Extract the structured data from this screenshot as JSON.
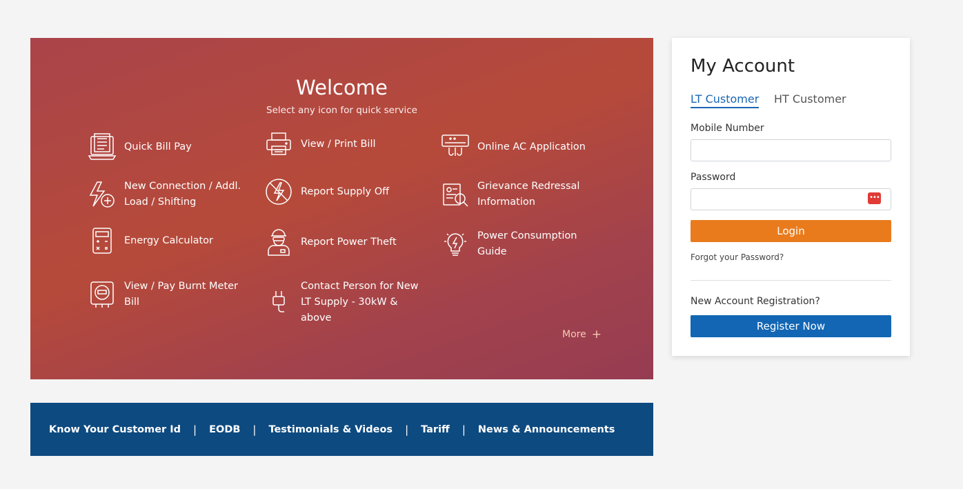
{
  "welcome": {
    "title": "Welcome",
    "subtitle": "Select any icon for quick service",
    "services": [
      {
        "label": "Quick Bill Pay",
        "icon": "bill-pay-icon"
      },
      {
        "label": "View / Print Bill",
        "icon": "printer-icon"
      },
      {
        "label": "Online AC Application",
        "icon": "air-conditioner-icon"
      },
      {
        "label": "New Connection / Addl. Load / Shifting",
        "icon": "lightning-plus-icon"
      },
      {
        "label": "Report Supply Off",
        "icon": "supply-off-icon"
      },
      {
        "label": "Grievance Redressal Information",
        "icon": "grievance-search-icon"
      },
      {
        "label": "Energy Calculator",
        "icon": "calculator-icon"
      },
      {
        "label": "Report Power Theft",
        "icon": "thief-icon"
      },
      {
        "label": "Power Consumption Guide",
        "icon": "bulb-icon"
      },
      {
        "label": "View / Pay Burnt Meter Bill",
        "icon": "meter-icon"
      },
      {
        "label": "Contact Person for New LT Supply - 30kW & above",
        "icon": "plug-icon"
      }
    ],
    "more_label": "More",
    "more_icon": "plus-icon"
  },
  "bottom_links": [
    "Know Your Customer Id",
    "EODB",
    "Testimonials & Videos",
    "Tariff",
    "News & Announcements"
  ],
  "account": {
    "title": "My Account",
    "tabs": [
      "LT Customer",
      "HT Customer"
    ],
    "active_tab": "LT Customer",
    "mobile_label": "Mobile Number",
    "mobile_value": "",
    "password_label": "Password",
    "password_value": "",
    "password_icon": "password-manager-icon",
    "login_label": "Login",
    "forgot_label": "Forgot your Password?",
    "new_account_label": "New Account Registration?",
    "register_label": "Register Now"
  },
  "colors": {
    "welcome_bg": "#b04642",
    "bottom_bar": "#0d4a80",
    "login_button": "#e97b1d",
    "register_button": "#1266b4",
    "active_tab": "#1966b4"
  }
}
